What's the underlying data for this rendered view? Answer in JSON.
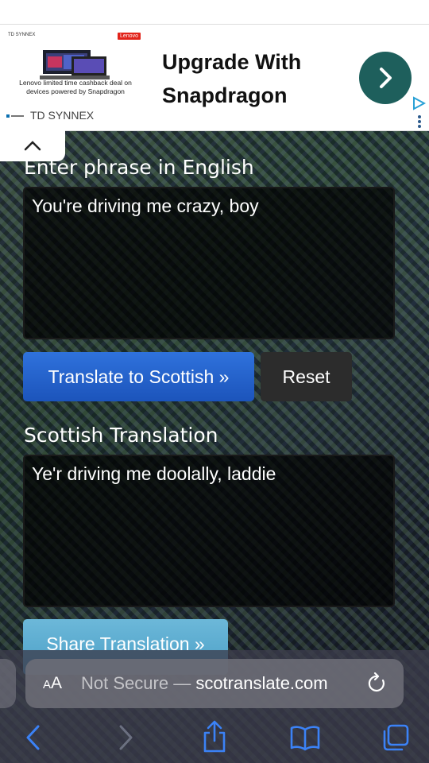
{
  "ad": {
    "tiny_logo_text": "TD SYNNEX",
    "brand_badge": "Lenovo",
    "caption": "Lenovo limited time cashback deal on devices powered by Snapdragon",
    "sponsor": "TD SYNNEX",
    "headline": "Upgrade With Snapdragon",
    "arrow_icon": "chevron-right-icon",
    "choice_icon": "ad-choices-icon"
  },
  "form": {
    "input_label": "Enter phrase in English",
    "input_value": "You're driving me crazy, boy",
    "translate_button": "Translate to Scottish »",
    "reset_button": "Reset",
    "output_label": "Scottish Translation",
    "output_value": "Ye'r driving me doolally, laddie",
    "share_button": "Share Translation »"
  },
  "browser": {
    "aa_small": "A",
    "aa_large": "A",
    "url_prefix": "Not Secure — ",
    "url_domain": "scotranslate.com",
    "icons": [
      "back-icon",
      "forward-icon",
      "share-icon",
      "bookmarks-icon",
      "tabs-icon",
      "reload-icon"
    ]
  },
  "colors": {
    "translate_button": "#2563d0",
    "reset_button": "#2c2c2c",
    "share_button": "#5aa9cf",
    "ad_arrow": "#1e5f5c"
  }
}
